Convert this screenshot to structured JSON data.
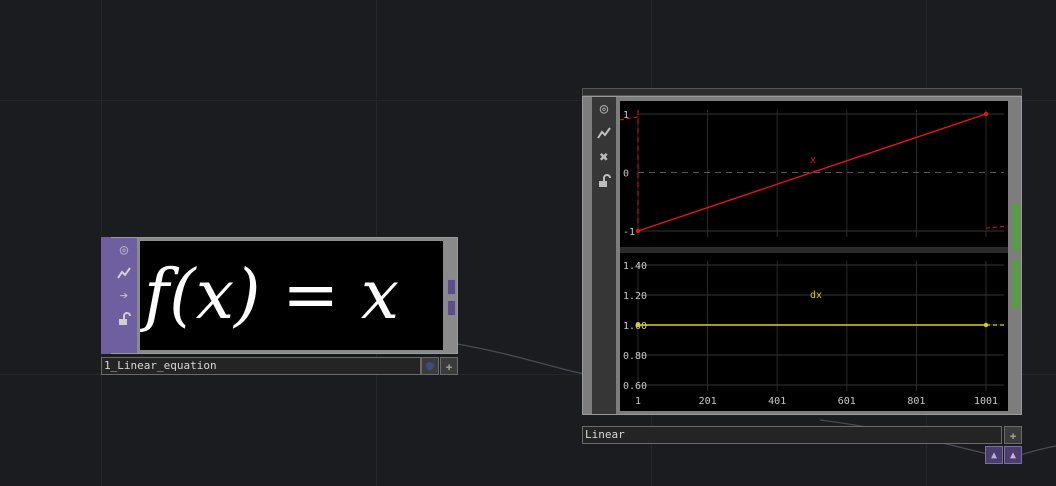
{
  "colors": {
    "background": "#1b1c20",
    "text_node_accent": "#6f5fa0",
    "red_channel": "#e01818",
    "yellow_channel": "#d8d21e",
    "wire": "#4a4b50",
    "viewer_flag": "#5a9a4a"
  },
  "text_node": {
    "name": "1_Linear_equation",
    "equation": "f(x) = x",
    "sidebar_icons": [
      "target-icon",
      "waveform-icon",
      "arrow-right-icon",
      "lock-icon"
    ]
  },
  "chop_node": {
    "name": "Linear",
    "sidebar_icons": [
      "target-icon",
      "waveform-icon",
      "close-icon",
      "lock-icon"
    ],
    "output_icons": [
      "up-arrow-icon",
      "up-arrow-icon"
    ]
  },
  "chart_data": [
    {
      "type": "line",
      "series": [
        {
          "name": "x",
          "x": [
            1,
            1001
          ],
          "values": [
            -1,
            1
          ]
        }
      ],
      "ylim": [
        -1,
        1
      ],
      "xlim": [
        1,
        1001
      ],
      "yticks": [
        "1",
        "0",
        "-1"
      ],
      "grid": true
    },
    {
      "type": "line",
      "series": [
        {
          "name": "dx",
          "x": [
            1,
            1001
          ],
          "values": [
            1.0,
            1.0
          ]
        }
      ],
      "ylim": [
        0.6,
        1.4
      ],
      "xlim": [
        1,
        1001
      ],
      "yticks": [
        "1.40",
        "1.20",
        "1.00",
        "0.80",
        "0.60"
      ],
      "xticks": [
        "1",
        "201",
        "401",
        "601",
        "801",
        "1001"
      ],
      "grid": true
    }
  ]
}
